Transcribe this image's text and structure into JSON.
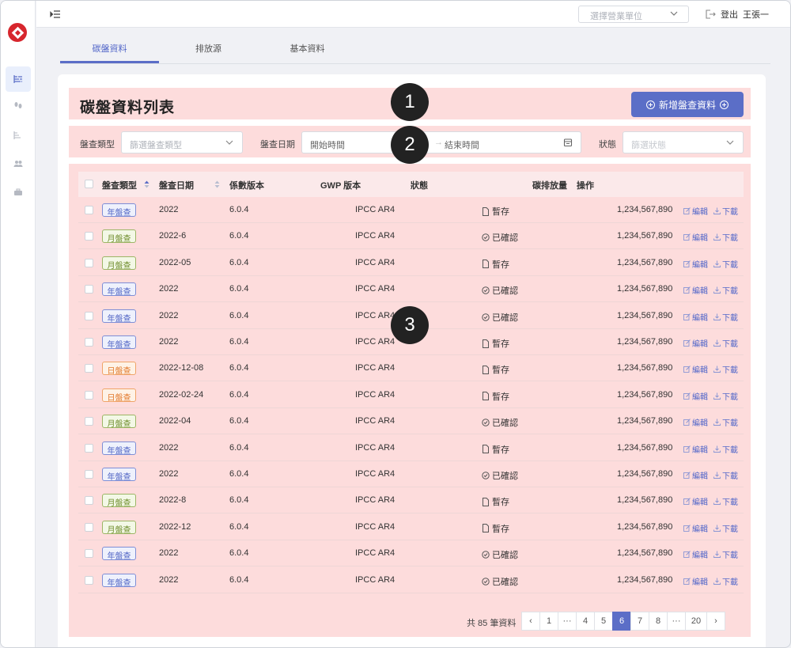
{
  "header": {
    "unit_placeholder": "選擇營業單位",
    "logout_label": "登出",
    "user_name": "王張一"
  },
  "tabs": [
    {
      "label": "碳盤資料",
      "active": true
    },
    {
      "label": "排放源",
      "active": false
    },
    {
      "label": "基本資料",
      "active": false
    }
  ],
  "page": {
    "title": "碳盤資料列表",
    "add_button": "新增盤查資料"
  },
  "zone_markers": [
    "1",
    "2",
    "3"
  ],
  "filters": {
    "type_label": "盤查類型",
    "type_placeholder": "篩選盤查類型",
    "date_label": "盤查日期",
    "start_placeholder": "開始時間",
    "end_placeholder": "結束時間",
    "status_label": "狀態",
    "status_placeholder": "篩選狀態"
  },
  "table": {
    "headers": [
      "盤查類型",
      "盤查日期",
      "係數版本",
      "GWP 版本",
      "狀態",
      "碳排放量",
      "操作"
    ],
    "edit_label": "編輯",
    "download_label": "下載",
    "rows": [
      {
        "type": "年盤查",
        "color": "blue",
        "date": "2022",
        "coef": "6.0.4",
        "gwp": "IPCC AR4",
        "status": "暫存",
        "status_icon": "file-icon",
        "amount": "1,234,567,890"
      },
      {
        "type": "月盤查",
        "color": "green",
        "date": "2022-6",
        "coef": "6.0.4",
        "gwp": "IPCC AR4",
        "status": "已確認",
        "status_icon": "check-circle-icon",
        "amount": "1,234,567,890"
      },
      {
        "type": "月盤查",
        "color": "green",
        "date": "2022-05",
        "coef": "6.0.4",
        "gwp": "IPCC AR4",
        "status": "暫存",
        "status_icon": "file-icon",
        "amount": "1,234,567,890"
      },
      {
        "type": "年盤查",
        "color": "blue",
        "date": "2022",
        "coef": "6.0.4",
        "gwp": "IPCC AR4",
        "status": "已確認",
        "status_icon": "check-circle-icon",
        "amount": "1,234,567,890"
      },
      {
        "type": "年盤查",
        "color": "blue",
        "date": "2022",
        "coef": "6.0.4",
        "gwp": "IPCC AR4",
        "status": "已確認",
        "status_icon": "check-circle-icon",
        "amount": "1,234,567,890"
      },
      {
        "type": "年盤查",
        "color": "blue",
        "date": "2022",
        "coef": "6.0.4",
        "gwp": "IPCC AR4",
        "status": "暫存",
        "status_icon": "file-icon",
        "amount": "1,234,567,890"
      },
      {
        "type": "日盤查",
        "color": "orange",
        "date": "2022-12-08",
        "coef": "6.0.4",
        "gwp": "IPCC AR4",
        "status": "暫存",
        "status_icon": "file-icon",
        "amount": "1,234,567,890"
      },
      {
        "type": "日盤查",
        "color": "orange",
        "date": "2022-02-24",
        "coef": "6.0.4",
        "gwp": "IPCC AR4",
        "status": "暫存",
        "status_icon": "file-icon",
        "amount": "1,234,567,890"
      },
      {
        "type": "月盤查",
        "color": "green",
        "date": "2022-04",
        "coef": "6.0.4",
        "gwp": "IPCC AR4",
        "status": "已確認",
        "status_icon": "check-circle-icon",
        "amount": "1,234,567,890"
      },
      {
        "type": "年盤查",
        "color": "blue",
        "date": "2022",
        "coef": "6.0.4",
        "gwp": "IPCC AR4",
        "status": "暫存",
        "status_icon": "file-icon",
        "amount": "1,234,567,890"
      },
      {
        "type": "年盤查",
        "color": "blue",
        "date": "2022",
        "coef": "6.0.4",
        "gwp": "IPCC AR4",
        "status": "已確認",
        "status_icon": "check-circle-icon",
        "amount": "1,234,567,890"
      },
      {
        "type": "月盤查",
        "color": "green",
        "date": "2022-8",
        "coef": "6.0.4",
        "gwp": "IPCC AR4",
        "status": "暫存",
        "status_icon": "file-icon",
        "amount": "1,234,567,890"
      },
      {
        "type": "月盤查",
        "color": "green",
        "date": "2022-12",
        "coef": "6.0.4",
        "gwp": "IPCC AR4",
        "status": "暫存",
        "status_icon": "file-icon",
        "amount": "1,234,567,890"
      },
      {
        "type": "年盤查",
        "color": "blue",
        "date": "2022",
        "coef": "6.0.4",
        "gwp": "IPCC AR4",
        "status": "已確認",
        "status_icon": "check-circle-icon",
        "amount": "1,234,567,890"
      },
      {
        "type": "年盤查",
        "color": "blue",
        "date": "2022",
        "coef": "6.0.4",
        "gwp": "IPCC AR4",
        "status": "已確認",
        "status_icon": "check-circle-icon",
        "amount": "1,234,567,890"
      }
    ]
  },
  "pagination": {
    "total_text": "共 85 筆資料",
    "pages": [
      "‹",
      "1",
      "···",
      "4",
      "5",
      "6",
      "7",
      "8",
      "···",
      "20",
      "›"
    ],
    "current": "6"
  },
  "colors": {
    "accent": "#5b6ec7",
    "annotation_zone": "#fddcdc",
    "brand_red": "#d7262d"
  }
}
